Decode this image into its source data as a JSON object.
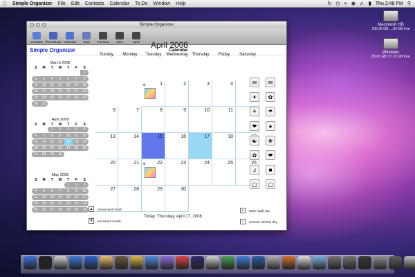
{
  "menubar": {
    "app": "Simple Organizer",
    "menus": [
      "File",
      "Edit",
      "Contacts",
      "Calendar",
      "To Do",
      "Window",
      "Help"
    ],
    "clock": "Thu 2:48 PM"
  },
  "desktop": {
    "icons": [
      {
        "name": "Macintosh HD",
        "info": "100.36 GB, ...64 GB free"
      },
      {
        "name": "Windows",
        "info": "83.81 GB, 57.22 GB free"
      }
    ]
  },
  "window": {
    "title": "Simple Organizer",
    "toolbar": [
      {
        "label": "Contacts",
        "icon": "contacts-icon",
        "color": "#5b7fd6"
      },
      {
        "label": "PhoneBook",
        "icon": "phonebook-icon",
        "color": "#4a64b8"
      },
      {
        "label": "Calendar",
        "icon": "calendar-icon",
        "color": "#4f73cf"
      },
      {
        "label": "ToDo",
        "icon": "todo-icon",
        "color": "#6b7bb9"
      },
      {
        "label": "Previous",
        "icon": "previous-icon",
        "color": "#444444"
      },
      {
        "label": "Next",
        "icon": "next-icon",
        "color": "#444444"
      },
      {
        "label": "Save",
        "icon": "save-icon",
        "color": "#444444"
      }
    ],
    "app_name": "Simple Organizer",
    "section": "Calendar"
  },
  "mini_calendars": [
    {
      "title": "March 2008",
      "first_weekday": 6,
      "days": 31,
      "selected": null
    },
    {
      "title": "April 2008",
      "first_weekday": 2,
      "days": 30,
      "selected": 17
    },
    {
      "title": "May 2008",
      "first_weekday": 4,
      "days": 31,
      "selected": null
    }
  ],
  "weekdays_short": [
    "S",
    "M",
    "T",
    "W",
    "T",
    "F",
    "S"
  ],
  "calendar": {
    "month_title": "April 2008",
    "weekdays": [
      "Sunday",
      "Monday",
      "Tuesday",
      "Wednesday",
      "Thursday",
      "Friday",
      "Saturday"
    ],
    "first_weekday": 2,
    "days": 30,
    "marked_days": [
      1,
      22
    ],
    "highlight_days": [
      {
        "day": 15,
        "color": "#6176ea"
      },
      {
        "day": 17,
        "color": "#99d8f5"
      }
    ]
  },
  "stickers": [
    "✉",
    "✉",
    "☀",
    "✿",
    "⚘",
    "☂",
    "❤",
    "●",
    "☯",
    "❀",
    "✿",
    "❤",
    "♫",
    "■",
    "▢",
    "▢"
  ],
  "controls": {
    "decrement": "Decrement month",
    "increment": "Increment month",
    "mark": "Mark (add) day",
    "unmark": "Unmark (delete) day",
    "today": "Today: Thursday, April 17, 2008"
  },
  "dock": {
    "colors": [
      "#3b6fd6",
      "#222222",
      "#cfcfcf",
      "#3d7bd9",
      "#2b62c9",
      "#e8c070",
      "#6b5a40",
      "#d9b84a",
      "#4c8ad8",
      "#8a6cd8",
      "#d74444",
      "#2d2d6b",
      "#d0d0d0",
      "#4aa05a",
      "#3f7fd6",
      "#2b5f9f",
      "#b0b0b0",
      "#d07030",
      "#e0e0e0",
      "#7bb0d9",
      "#707070",
      "#707070",
      "#3a3a3a",
      "#909090",
      "#5d5d5d",
      "#bfbfbf"
    ]
  }
}
